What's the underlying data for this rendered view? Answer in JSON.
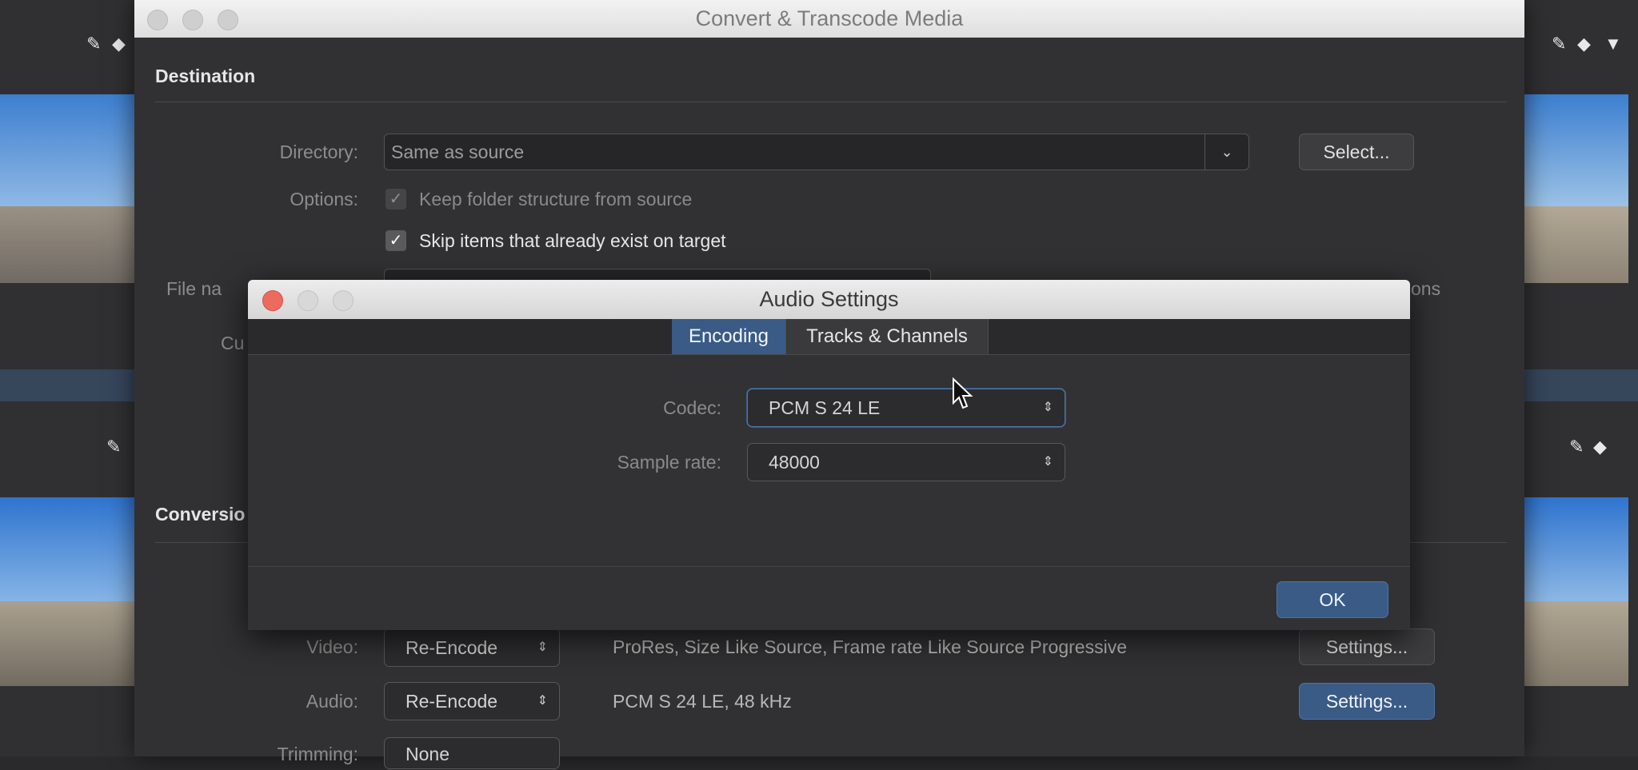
{
  "main_window": {
    "title": "Convert & Transcode Media",
    "destination": {
      "heading": "Destination",
      "directory_label": "Directory:",
      "directory_value": "Same as source",
      "select_button": "Select...",
      "options_label": "Options:",
      "keep_folder_label": "Keep folder structure from source",
      "keep_folder_checked": true,
      "skip_items_label": "Skip items that already exist on target",
      "skip_items_checked": true,
      "file_name_label_partial": "File na",
      "custom_label_partial": "Cu",
      "options_button_partial": "ons"
    },
    "conversion": {
      "heading_partial": "Conversio",
      "video_label": "Video:",
      "video_mode": "Re-Encode",
      "video_summary": "ProRes, Size Like Source, Frame rate Like Source Progressive",
      "video_settings": "Settings...",
      "audio_label": "Audio:",
      "audio_mode": "Re-Encode",
      "audio_summary": "PCM S 24 LE, 48 kHz",
      "audio_settings": "Settings...",
      "trimming_label_partial": "Trimming:",
      "trimming_value_partial": "None"
    }
  },
  "audio_dialog": {
    "title": "Audio Settings",
    "tabs": [
      {
        "label": "Encoding",
        "active": true
      },
      {
        "label": "Tracks & Channels",
        "active": false
      }
    ],
    "codec_label": "Codec:",
    "codec_value": "PCM S 24 LE",
    "sample_rate_label": "Sample rate:",
    "sample_rate_value": "48000",
    "ok_button": "OK"
  },
  "colors": {
    "accent_blue": "#3a5b85",
    "close_red": "#ed6a5e"
  }
}
